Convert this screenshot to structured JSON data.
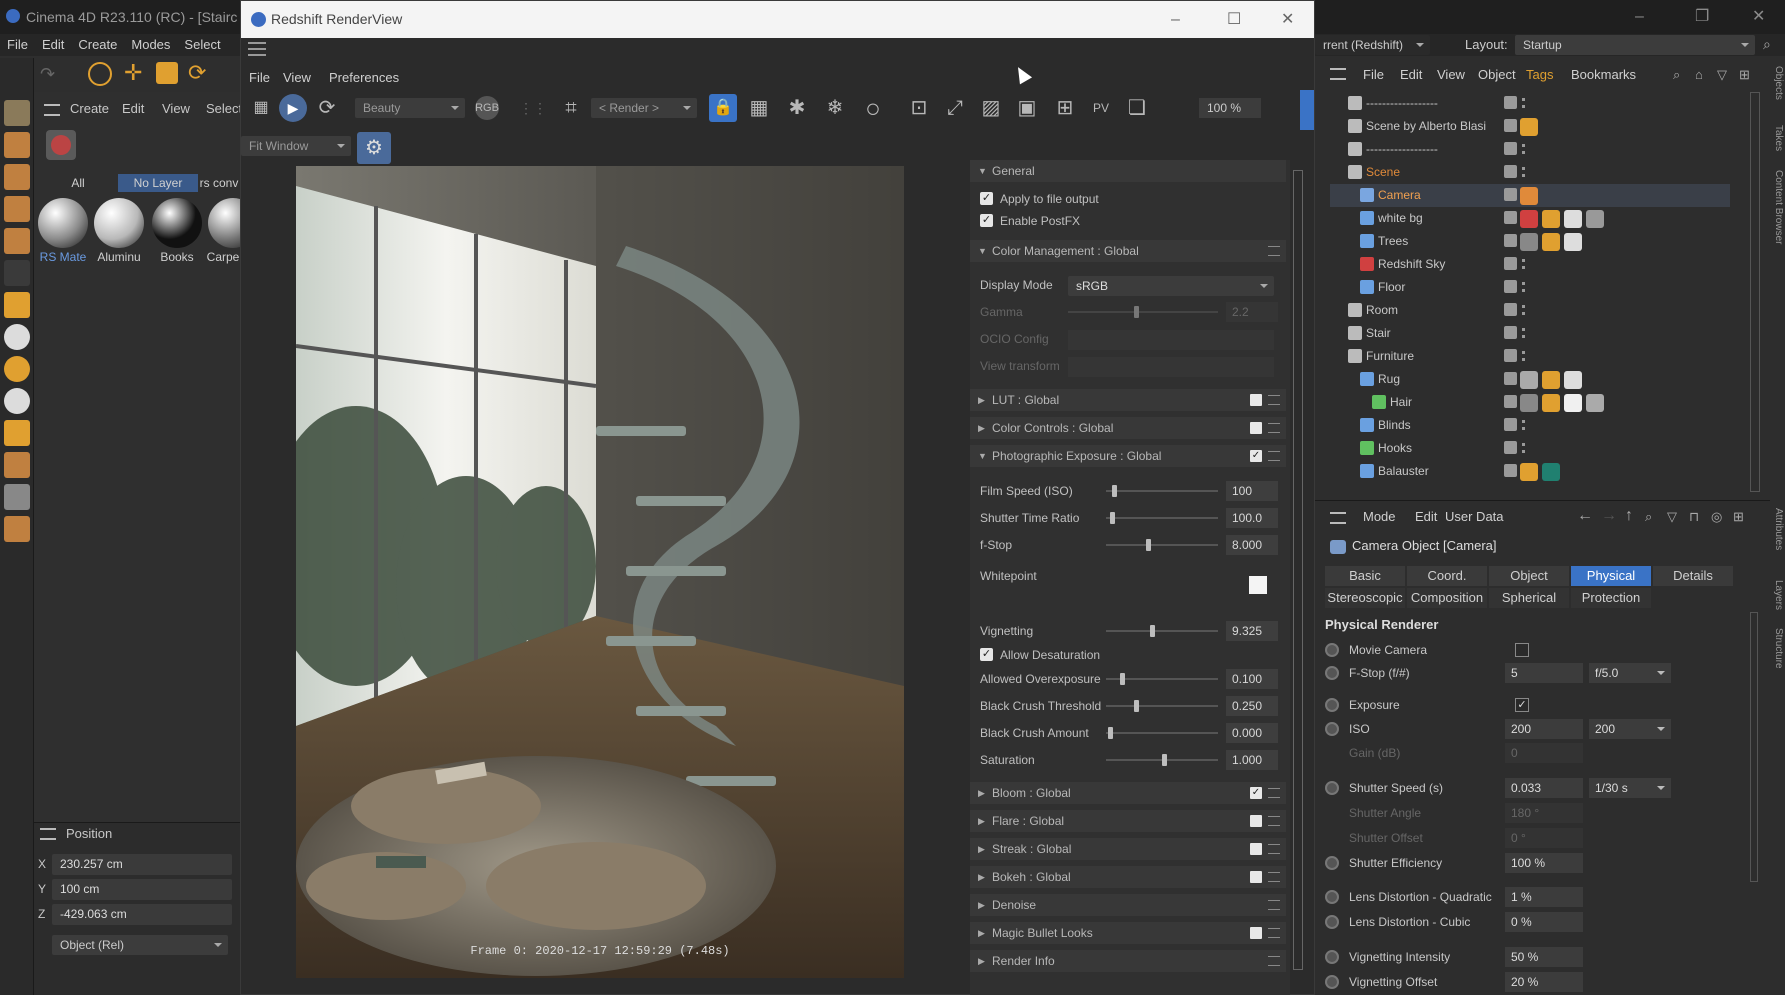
{
  "c4d": {
    "title": "Cinema 4D R23.110 (RC) - [Stairc",
    "menu": [
      "File",
      "Edit",
      "Create",
      "Modes",
      "Select"
    ],
    "material_menu": [
      "Create",
      "Edit",
      "View",
      "Select"
    ],
    "material_tabs": [
      "All",
      "No Layer",
      "rs conv"
    ],
    "materials": [
      {
        "label": "RS Mate",
        "color": "#8a8a8a"
      },
      {
        "label": "Aluminu",
        "color": "#b8b8b8"
      },
      {
        "label": "Books",
        "color": "#111111"
      },
      {
        "label": "Carpe",
        "color": "#777777"
      }
    ],
    "coords": {
      "header": "Position",
      "x_label": "X",
      "x": "230.257 cm",
      "y_label": "Y",
      "y": "100 cm",
      "z_label": "Z",
      "z": "-429.063 cm",
      "mode": "Object (Rel)"
    }
  },
  "renderview": {
    "title": "Redshift RenderView",
    "menu": [
      "File",
      "View",
      "Preferences"
    ],
    "aov_select": "Beauty",
    "render_select": "< Render >",
    "zoom": "100 %",
    "fit_select": "Fit Window",
    "frame_info": "Frame  0:  2020-12-17  12:59:29  (7.48s)"
  },
  "settings": {
    "general": "General",
    "apply_file_output": "Apply to file output",
    "enable_postfx": "Enable PostFX",
    "color_mgmt": "Color Management  : Global",
    "display_mode_label": "Display Mode",
    "display_mode": "sRGB",
    "gamma_label": "Gamma",
    "gamma": "2.2",
    "ocio_label": "OCIO Config",
    "view_transform_label": "View transform",
    "lut": "LUT  : Global",
    "color_controls": "Color Controls  : Global",
    "photo_exposure": "Photographic Exposure  : Global",
    "film_speed_label": "Film Speed (ISO)",
    "film_speed": "100",
    "shutter_ratio_label": "Shutter Time Ratio",
    "shutter_ratio": "100.0",
    "fstop_label": "f-Stop",
    "fstop": "8.000",
    "whitepoint_label": "Whitepoint",
    "vignetting_label": "Vignetting",
    "vignetting": "9.325",
    "allow_desat": "Allow Desaturation",
    "overexposure_label": "Allowed Overexposure",
    "overexposure": "0.100",
    "crush_threshold_label": "Black Crush Threshold",
    "crush_threshold": "0.250",
    "crush_amount_label": "Black Crush Amount",
    "crush_amount": "0.000",
    "saturation_label": "Saturation",
    "saturation": "1.000",
    "bloom": "Bloom  : Global",
    "flare": "Flare  : Global",
    "streak": "Streak  : Global",
    "bokeh": "Bokeh  : Global",
    "denoise": "Denoise",
    "magic_bullet": "Magic Bullet Looks",
    "render_info": "Render Info"
  },
  "objects": {
    "top_left": "rrent (Redshift)",
    "layout_label": "Layout:",
    "layout": "Startup",
    "menu": [
      "File",
      "Edit",
      "View",
      "Object",
      "Tags",
      "Bookmarks"
    ],
    "rows": [
      {
        "name": "------------------",
        "indent": 0,
        "color": "#c8c8c8"
      },
      {
        "name": "Scene by Alberto Blasi",
        "indent": 0,
        "color": "#c8c8c8"
      },
      {
        "name": "------------------",
        "indent": 0,
        "color": "#c8c8c8"
      },
      {
        "name": "Scene",
        "indent": 0,
        "color": "#e08a3a"
      },
      {
        "name": "Camera",
        "indent": 1,
        "color": "#f0a050"
      },
      {
        "name": "white bg",
        "indent": 1,
        "color": "#c8c8c8"
      },
      {
        "name": "Trees",
        "indent": 1,
        "color": "#c8c8c8"
      },
      {
        "name": "Redshift Sky",
        "indent": 1,
        "color": "#c8c8c8"
      },
      {
        "name": "Floor",
        "indent": 1,
        "color": "#c8c8c8"
      },
      {
        "name": "Room",
        "indent": 0,
        "color": "#c8c8c8"
      },
      {
        "name": "Stair",
        "indent": 0,
        "color": "#c8c8c8"
      },
      {
        "name": "Furniture",
        "indent": 0,
        "color": "#c8c8c8"
      },
      {
        "name": "Rug",
        "indent": 1,
        "color": "#c8c8c8"
      },
      {
        "name": "Hair",
        "indent": 2,
        "color": "#c8c8c8"
      },
      {
        "name": "Blinds",
        "indent": 1,
        "color": "#c8c8c8"
      },
      {
        "name": "Hooks",
        "indent": 1,
        "color": "#c8c8c8"
      },
      {
        "name": "Balauster",
        "indent": 1,
        "color": "#c8c8c8"
      }
    ]
  },
  "attributes": {
    "menu": [
      "Mode",
      "Edit",
      "User Data"
    ],
    "object_title": "Camera Object [Camera]",
    "tabs_row1": [
      "Basic",
      "Coord.",
      "Object",
      "Physical",
      "Details"
    ],
    "tabs_row2": [
      "Stereoscopic",
      "Composition",
      "Spherical",
      "Protection"
    ],
    "active_tab": "Physical",
    "section": "Physical Renderer",
    "movie_camera": "Movie Camera",
    "fstop_label": "F-Stop (f/#)",
    "fstop": "5",
    "fstop_preset": "f/5.0",
    "exposure": "Exposure",
    "iso_label": "ISO",
    "iso": "200",
    "iso_preset": "200",
    "gain_label": "Gain (dB)",
    "gain": "0",
    "shutter_speed_label": "Shutter Speed (s)",
    "shutter_speed": "0.033",
    "shutter_preset": "1/30 s",
    "shutter_angle_label": "Shutter Angle",
    "shutter_angle": "180 °",
    "shutter_offset_label": "Shutter Offset",
    "shutter_offset": "0 °",
    "shutter_eff_label": "Shutter Efficiency",
    "shutter_eff": "100 %",
    "lens_quad_label": "Lens Distortion - Quadratic",
    "lens_quad": "1 %",
    "lens_cubic_label": "Lens Distortion - Cubic",
    "lens_cubic": "0 %",
    "vig_int_label": "Vignetting Intensity",
    "vig_int": "50 %",
    "vig_off_label": "Vignetting Offset",
    "vig_off": "20 %"
  },
  "side_tabs": [
    "Objects",
    "Takes",
    "Content Browser",
    "Attributes",
    "Layers",
    "Structure"
  ]
}
